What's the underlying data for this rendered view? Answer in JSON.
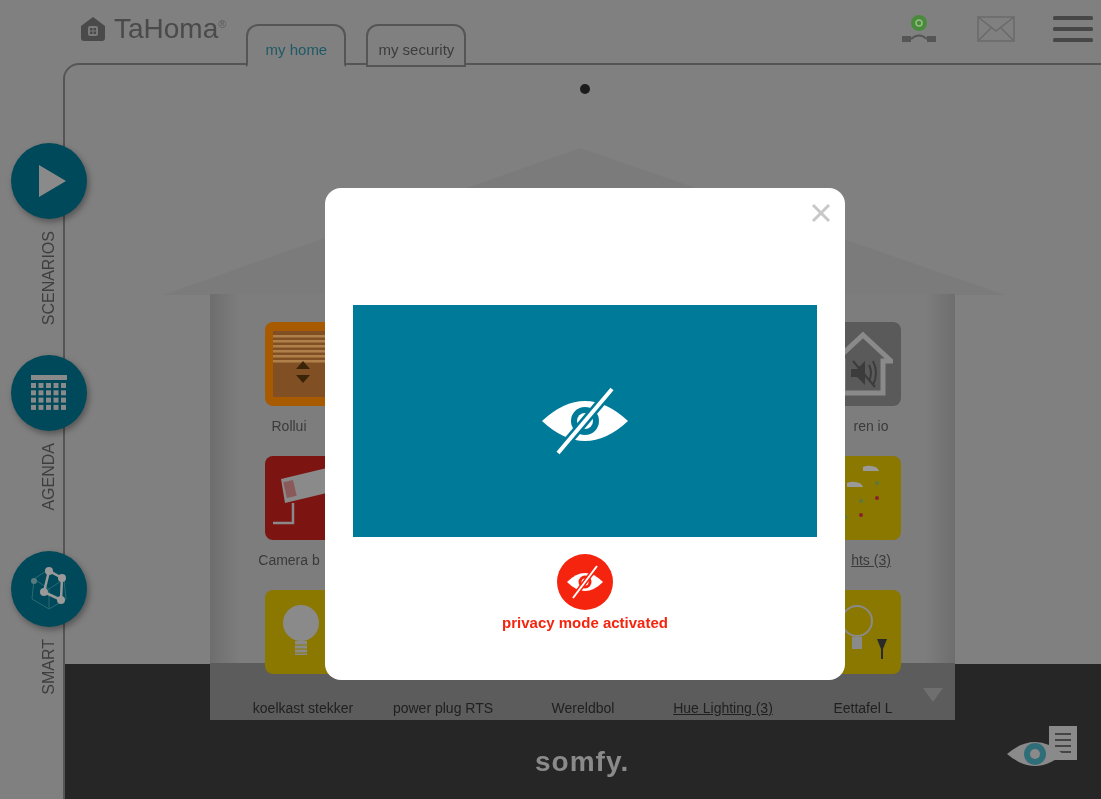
{
  "header": {
    "logo": "TaHoma",
    "logo_mark": "®",
    "tabs": [
      {
        "label": "my home",
        "selected": true
      },
      {
        "label": "my security",
        "selected": false
      }
    ]
  },
  "sidebar": {
    "items": [
      {
        "label": "SCENARIOS",
        "kind": "play"
      },
      {
        "label": "AGENDA",
        "kind": "calendar"
      },
      {
        "label": "SMART",
        "kind": "network"
      }
    ]
  },
  "pager": [
    {
      "selected": true
    }
  ],
  "device_rows": [
    {
      "items": [
        {
          "label": "Rollui",
          "kind": "shutter",
          "group": false
        },
        {
          "label": "ren io",
          "kind": "siren",
          "group": false
        }
      ]
    },
    {
      "items": [
        {
          "label": "Camera b",
          "kind": "camera",
          "group": false
        },
        {
          "label": "hts (3)",
          "kind": "light_group",
          "group": true
        }
      ]
    },
    {
      "items": [
        {
          "label": "koelkast stekker",
          "kind": "bulb",
          "group": false
        },
        {
          "label": "power plug RTS",
          "kind": "covered",
          "group": false
        },
        {
          "label": "Wereldbol",
          "kind": "covered",
          "group": false
        },
        {
          "label": "Hue Lighting (3)",
          "kind": "covered",
          "group": true
        },
        {
          "label": "Eettafel L",
          "kind": "hue_bulb",
          "group": false
        }
      ]
    }
  ],
  "footer": {
    "brand": "somfy."
  },
  "dialog": {
    "status": "privacy mode activated",
    "privacy": true
  }
}
